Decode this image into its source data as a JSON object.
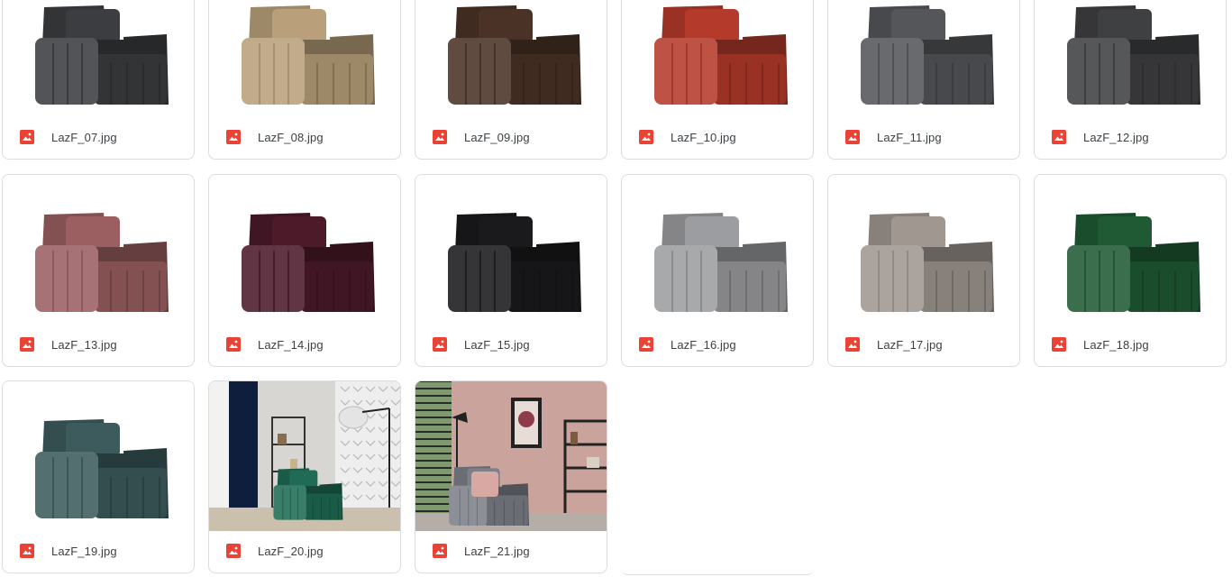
{
  "files": [
    {
      "name": "LazF_07.jpg",
      "kind": "chair",
      "color": "#3b3d40"
    },
    {
      "name": "LazF_08.jpg",
      "kind": "chair",
      "color": "#b9a07a"
    },
    {
      "name": "LazF_09.jpg",
      "kind": "chair",
      "color": "#4a3326"
    },
    {
      "name": "LazF_10.jpg",
      "kind": "chair",
      "color": "#b43a2c"
    },
    {
      "name": "LazF_11.jpg",
      "kind": "chair",
      "color": "#555659"
    },
    {
      "name": "LazF_12.jpg",
      "kind": "chair",
      "color": "#3f4042"
    },
    {
      "name": "LazF_13.jpg",
      "kind": "chair",
      "color": "#9b5f62"
    },
    {
      "name": "LazF_14.jpg",
      "kind": "chair",
      "color": "#4d1a2a"
    },
    {
      "name": "LazF_15.jpg",
      "kind": "chair",
      "color": "#1a1a1c"
    },
    {
      "name": "LazF_16.jpg",
      "kind": "chair",
      "color": "#9c9da0"
    },
    {
      "name": "LazF_17.jpg",
      "kind": "chair",
      "color": "#a09790"
    },
    {
      "name": "LazF_18.jpg",
      "kind": "chair",
      "color": "#1f5a34"
    },
    {
      "name": "LazF_19.jpg",
      "kind": "chair",
      "color": "#3d5b5c"
    },
    {
      "name": "LazF_20.jpg",
      "kind": "room-green",
      "color": "#1f6b55"
    },
    {
      "name": "LazF_21.jpg",
      "kind": "room-pink",
      "color": "#7d8088"
    }
  ],
  "icon": {
    "name": "image-file-icon",
    "color": "#ea4335"
  }
}
